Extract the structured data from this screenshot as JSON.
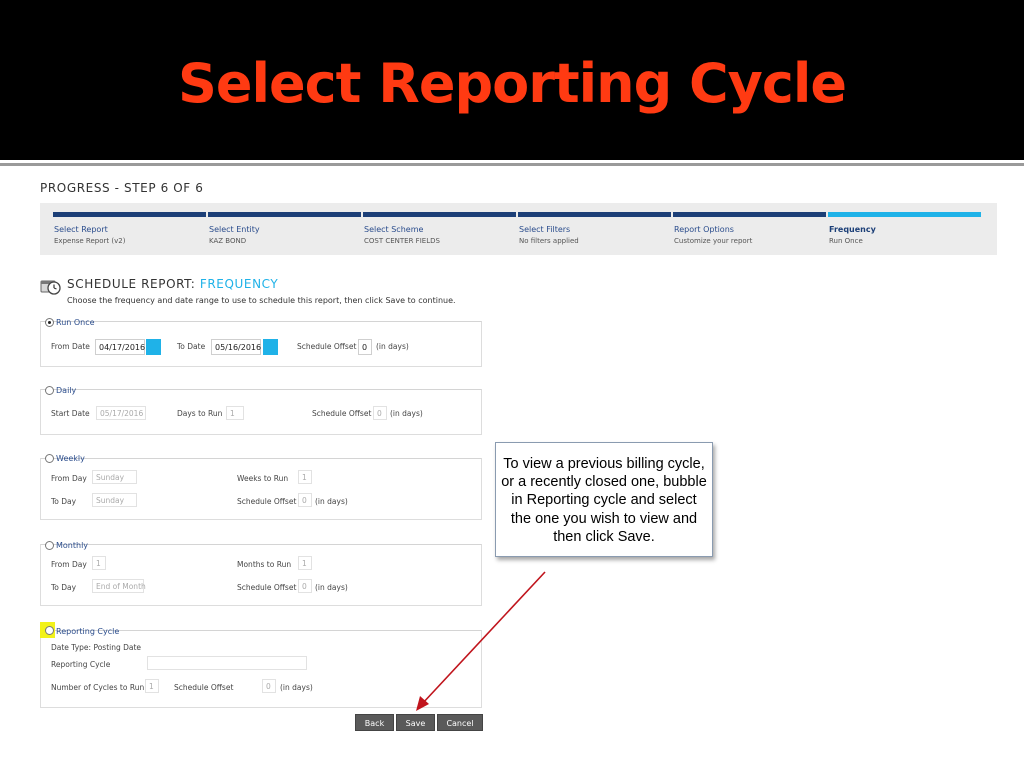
{
  "slide": {
    "title": "Select Reporting Cycle"
  },
  "progress": {
    "heading": "PROGRESS - STEP 6 OF 6",
    "steps": [
      {
        "name": "Select Report",
        "sub": "Expense Report (v2)"
      },
      {
        "name": "Select Entity",
        "sub": "KAZ BOND"
      },
      {
        "name": "Select Scheme",
        "sub": "COST CENTER FIELDS"
      },
      {
        "name": "Select Filters",
        "sub": "No filters applied"
      },
      {
        "name": "Report Options",
        "sub": "Customize your report"
      },
      {
        "name": "Frequency",
        "sub": "Run Once"
      }
    ]
  },
  "schedule": {
    "icon": "calendar-clock-icon",
    "heading_prefix": "SCHEDULE REPORT: ",
    "heading_accent": "FREQUENCY",
    "description": "Choose the frequency and date range to use to schedule this report, then click Save to continue."
  },
  "run_once": {
    "label": "Run Once",
    "from_date_label": "From Date",
    "from_date": "04/17/2016",
    "to_date_label": "To Date",
    "to_date": "05/16/2016",
    "offset_label": "Schedule Offset",
    "offset": "0",
    "offset_unit": "(in days)"
  },
  "daily": {
    "label": "Daily",
    "start_date_label": "Start Date",
    "start_date": "05/17/2016",
    "days_label": "Days to Run",
    "days": "1",
    "offset_label": "Schedule Offset",
    "offset": "0",
    "offset_unit": "(in days)"
  },
  "weekly": {
    "label": "Weekly",
    "from_day_label": "From Day",
    "from_day": "Sunday",
    "to_day_label": "To Day",
    "to_day": "Sunday",
    "weeks_label": "Weeks to Run",
    "weeks": "1",
    "offset_label": "Schedule Offset",
    "offset": "0",
    "offset_unit": "(in days)"
  },
  "monthly": {
    "label": "Monthly",
    "from_day_label": "From Day",
    "from_day": "1",
    "to_day_label": "To Day",
    "to_day": "End of Month",
    "months_label": "Months to Run",
    "months": "1",
    "offset_label": "Schedule Offset",
    "offset": "0",
    "offset_unit": "(in days)"
  },
  "reporting_cycle": {
    "label": "Reporting Cycle",
    "date_type": "Date Type: Posting Date",
    "cycle_label": "Reporting Cycle",
    "cycle": "",
    "num_cycles_label": "Number of Cycles to Run",
    "num_cycles": "1",
    "offset_label": "Schedule Offset",
    "offset": "0",
    "offset_unit": "(in days)"
  },
  "buttons": {
    "back": "Back",
    "save": "Save",
    "cancel": "Cancel"
  },
  "callout": {
    "lines": [
      "To view a previous billing cycle,",
      "or a recently closed one, bubble",
      "in Reporting cycle and select",
      "the one you wish to view  and",
      "then click Save."
    ]
  },
  "colors": {
    "title": "#ff3a12",
    "accent": "#1fb2e8",
    "progress_done": "#1c3f77",
    "highlight": "#f2f21a",
    "arrow": "#c0141c"
  }
}
